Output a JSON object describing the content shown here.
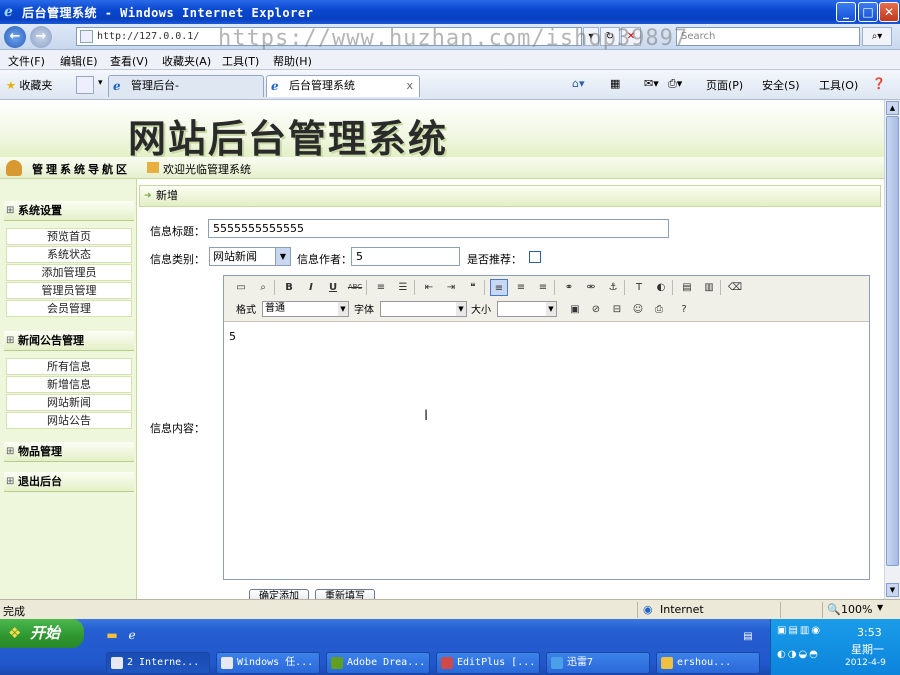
{
  "window": {
    "title": "后台管理系统 - Windows Internet Explorer",
    "min_label": "_",
    "max_label": "□",
    "close_label": "✕"
  },
  "address": {
    "url": "http://127.0.0.1/",
    "search_placeholder": "Search",
    "watermark": "https://www.huzhan.com/ishop39897"
  },
  "menubar": {
    "items": [
      "文件(F)",
      "编辑(E)",
      "查看(V)",
      "收藏夹(A)",
      "工具(T)",
      "帮助(H)"
    ]
  },
  "favbar": {
    "favorites": "收藏夹",
    "tabs": [
      {
        "label": "管理后台-"
      },
      {
        "label": "后台管理系统"
      }
    ],
    "commands": [
      "页面(P)",
      "安全(S)",
      "工具(O)"
    ]
  },
  "banner": {
    "title": "网站后台管理系统"
  },
  "nav": {
    "header": "管理系统导航区",
    "sections": [
      {
        "title": "系统设置",
        "items": [
          "预览首页",
          "系统状态",
          "添加管理员",
          "管理员管理",
          "会员管理"
        ]
      },
      {
        "title": "新闻公告管理",
        "items": [
          "所有信息",
          "新增信息",
          "网站新闻",
          "网站公告"
        ]
      },
      {
        "title": "物品管理",
        "items": []
      },
      {
        "title": "退出后台",
        "items": []
      }
    ]
  },
  "breadcrumb": {
    "welcome": "欢迎光临管理系统"
  },
  "form": {
    "section_title": "新增",
    "title_label": "信息标题：",
    "title_value": "5555555555555",
    "category_label": "信息类别：",
    "category_value": "网站新闻",
    "author_label": "信息作者：",
    "author_value": "5",
    "recommend_label": "是否推荐：",
    "recommend_checked": false,
    "content_label": "信息内容：",
    "content_value": "5",
    "submit_label": "确定添加",
    "reset_label": "重新填写"
  },
  "editor": {
    "format_label": "格式",
    "format_value": "普通",
    "font_label": "字体",
    "font_value": "",
    "size_label": "大小",
    "size_value": "",
    "toolbar_row1": [
      {
        "icon": "source-icon",
        "glyph": "▭"
      },
      {
        "icon": "preview-icon",
        "glyph": "⌕"
      },
      {
        "icon": "bold-icon",
        "glyph": "B"
      },
      {
        "icon": "italic-icon",
        "glyph": "I"
      },
      {
        "icon": "underline-icon",
        "glyph": "U"
      },
      {
        "icon": "strike-icon",
        "glyph": "ABC"
      },
      {
        "icon": "ordered-list-icon",
        "glyph": "≡"
      },
      {
        "icon": "unordered-list-icon",
        "glyph": "☰"
      },
      {
        "icon": "outdent-icon",
        "glyph": "⇤"
      },
      {
        "icon": "indent-icon",
        "glyph": "⇥"
      },
      {
        "icon": "blockquote-icon",
        "glyph": "❝"
      },
      {
        "icon": "align-left-icon",
        "glyph": "≡"
      },
      {
        "icon": "align-center-icon",
        "glyph": "≡"
      },
      {
        "icon": "align-right-icon",
        "glyph": "≡"
      },
      {
        "icon": "link-icon",
        "glyph": "⚭"
      },
      {
        "icon": "unlink-icon",
        "glyph": "⚮"
      },
      {
        "icon": "anchor-icon",
        "glyph": "⚓"
      },
      {
        "icon": "text-color-icon",
        "glyph": "T"
      },
      {
        "icon": "bg-color-icon",
        "glyph": "◐"
      },
      {
        "icon": "paste-text-icon",
        "glyph": "▤"
      },
      {
        "icon": "paste-word-icon",
        "glyph": "▥"
      },
      {
        "icon": "eraser-icon",
        "glyph": "⌫"
      }
    ],
    "toolbar_row2": [
      {
        "icon": "image-icon",
        "glyph": "▣"
      },
      {
        "icon": "flash-icon",
        "glyph": "⊘"
      },
      {
        "icon": "hr-icon",
        "glyph": "⊟"
      },
      {
        "icon": "smiley-icon",
        "glyph": "☺"
      },
      {
        "icon": "special-char-icon",
        "glyph": "⎙"
      },
      {
        "icon": "help-icon",
        "glyph": "?"
      }
    ]
  },
  "statusbar": {
    "status": "完成",
    "zone": "Internet",
    "zoom": "100%"
  },
  "taskbar": {
    "start": "开始",
    "tasks": [
      "2 Interne...",
      "Windows 任...",
      "Adobe Drea...",
      "EditPlus [...",
      "迅雷7",
      "ershou..."
    ],
    "time": "3:53",
    "day": "星期一",
    "date": "2012-4-9"
  }
}
